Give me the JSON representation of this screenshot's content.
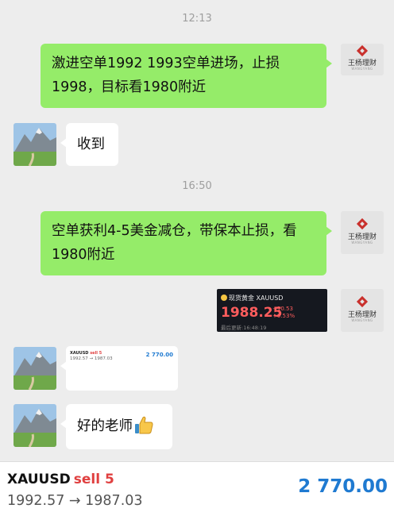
{
  "chat": {
    "time1": "12:13",
    "msg1": "激进空单1992 1993空单进场，止损1998，目标看1980附近",
    "reply1": "收到",
    "time2": "16:50",
    "msg2": "空单获利4-5美金减仓，带保本止损，看1980附近",
    "reply2": "好的老师",
    "reply2_emoji": "thumbs-up-emoji"
  },
  "sender": {
    "brand": "王杨理财",
    "brand_sub": "WANGYANG",
    "logo_icon": "diamond-logo-icon"
  },
  "quote": {
    "title": "现货黄金",
    "symbol": "XAUUSD",
    "price": "1988.25",
    "change": "+10.53",
    "change_pct": "+0.53%",
    "updated": "最后更新:16:48:19",
    "price_color": "#ff5d5d"
  },
  "trade": {
    "symbol": "XAUUSD",
    "side": "sell 5",
    "range": "1992.57 → 1987.03",
    "amount": "2 770.00",
    "amount_color": "#1f7ad1",
    "side_color": "#e04040"
  },
  "colors": {
    "background": "#ededed",
    "sent_bubble": "#95ec69",
    "received_bubble": "#ffffff"
  }
}
